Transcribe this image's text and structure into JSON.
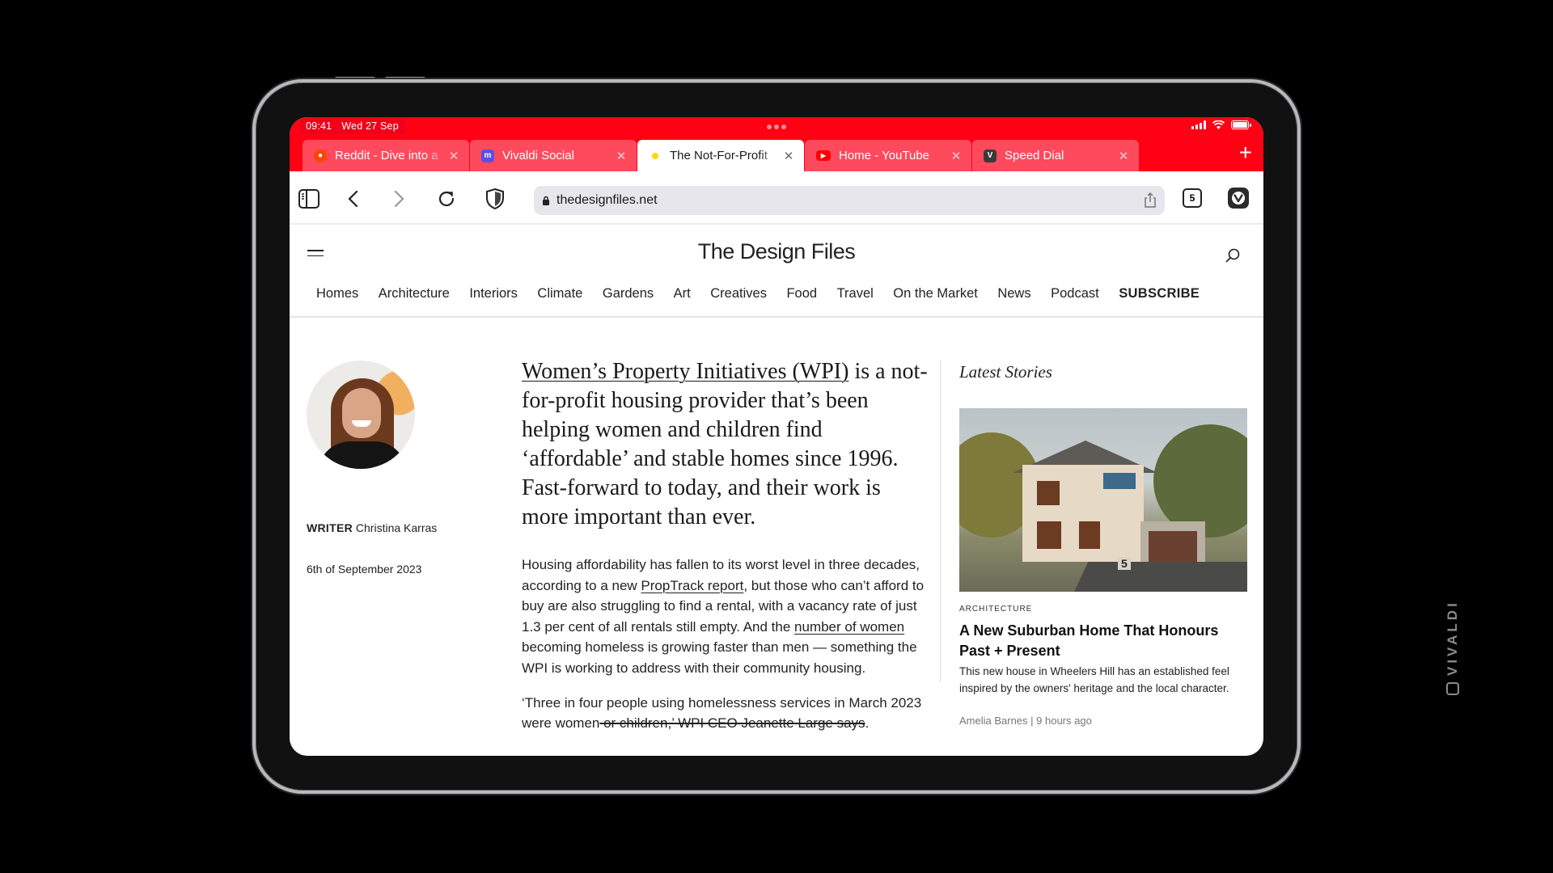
{
  "status_bar": {
    "time": "09:41",
    "date": "Wed 27 Sep"
  },
  "tabs": [
    {
      "title": "Reddit - Dive into a",
      "icon": "reddit-icon",
      "color": "#ff4500",
      "active": false
    },
    {
      "title": "Vivaldi Social",
      "icon": "mastodon-icon",
      "color": "#5a4fe0",
      "active": false
    },
    {
      "title": "The Not-For-Profit",
      "icon": "loading-dot-icon",
      "color": "#ffd60a",
      "active": true
    },
    {
      "title": "Home - YouTube",
      "icon": "youtube-icon",
      "color": "#ff0000",
      "active": false
    },
    {
      "title": "Speed Dial",
      "icon": "vivaldi-icon",
      "color": "#3a3a3a",
      "active": false
    }
  ],
  "toolbar": {
    "url": "thedesignfiles.net",
    "tab_count": "5"
  },
  "site": {
    "logo": "The Design Files",
    "nav": [
      "Homes",
      "Architecture",
      "Interiors",
      "Climate",
      "Gardens",
      "Art",
      "Creatives",
      "Food",
      "Travel",
      "On the Market",
      "News",
      "Podcast"
    ],
    "subscribe": "SUBSCRIBE"
  },
  "article": {
    "writer_label": "WRITER",
    "writer_name": "Christina Karras",
    "date": "6th of September 2023",
    "lead_link": "Women’s Property Initiatives (WPI)",
    "lead_rest": " is a not-for-profit housing provider that’s been helping women and children find ‘affordable’ and stable homes since 1996. Fast-forward to today, and their work is more important than ever.",
    "p1_a": "Housing affordability has fallen to its worst level in three decades, according to a new ",
    "p1_link1": "PropTrack report",
    "p1_b": ", but those who can’t afford to buy are also struggling to find a rental, with a vacancy rate of just 1.3 per cent of all rentals still empty. And the ",
    "p1_link2": "number of women",
    "p1_c": " becoming homeless is growing faster than men — something the WPI is working to address with their community housing.",
    "p2_a": "‘Three in four people using homelessness services in March 2023 were women",
    "p2_strike": " or children,’ WPI CEO Jeanette Large says",
    "p2_end": "."
  },
  "sidebar": {
    "heading": "Latest Stories",
    "story": {
      "category": "ARCHITECTURE",
      "title": "A New Suburban Home That Honours Past + Present",
      "description": "This new house in Wheelers Hill has an established feel inspired by the owners' heritage and the local character.",
      "meta": "Amelia Barnes | 9 hours ago",
      "house_number": "5"
    }
  },
  "watermark": "VIVALDI"
}
